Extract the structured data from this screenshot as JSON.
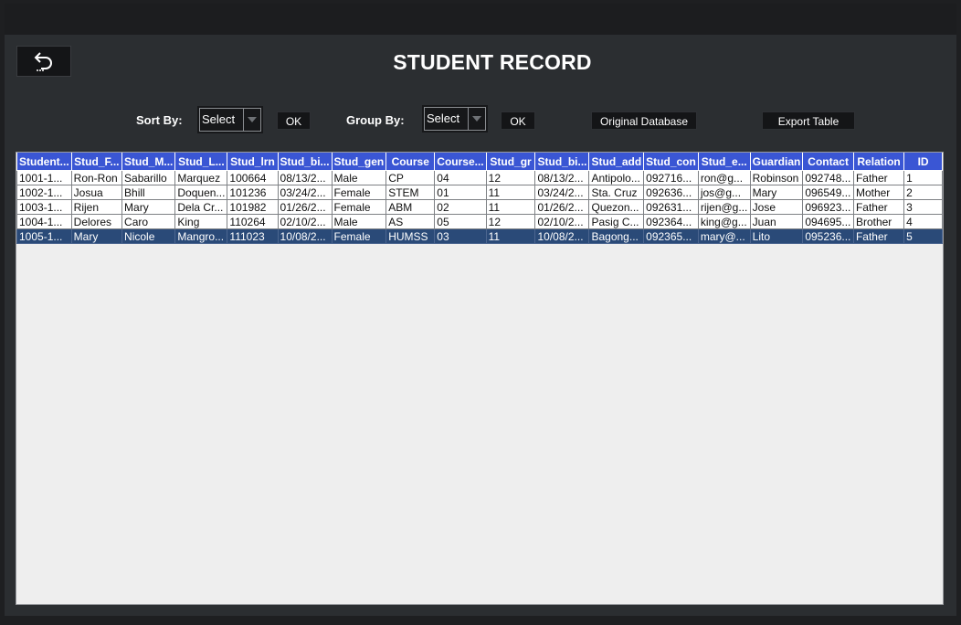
{
  "header": {
    "title": "STUDENT RECORD",
    "back_icon": "back-arrow-icon"
  },
  "controls": {
    "sort_label": "Sort By:",
    "sort_value": "Select",
    "sort_ok": "OK",
    "group_label": "Group By:",
    "group_value": "Select",
    "group_ok": "OK",
    "original_db": "Original Database",
    "export_table": "Export Table"
  },
  "table": {
    "columns": [
      "Student...",
      "Stud_F...",
      "Stud_M...",
      "Stud_L...",
      "Stud_lrn",
      "Stud_bi...",
      "Stud_gen",
      "Course",
      "Course...",
      "Stud_gr",
      "Stud_bi...",
      "Stud_add",
      "Stud_con",
      "Stud_e...",
      "Guardian",
      "Contact",
      "Relation",
      "ID"
    ],
    "rows": [
      [
        "1001-1...",
        "Ron-Ron",
        "Sabarillo",
        "Marquez",
        "100664",
        "08/13/2...",
        "Male",
        "CP",
        "04",
        "12",
        "08/13/2...",
        "Antipolo...",
        "092716...",
        "ron@g...",
        "Robinson",
        "092748...",
        "Father",
        "1"
      ],
      [
        "1002-1...",
        "Josua",
        "Bhill",
        "Doquen...",
        "101236",
        "03/24/2...",
        "Female",
        "STEM",
        "01",
        "11",
        "03/24/2...",
        "Sta. Cruz",
        "092636...",
        "jos@g...",
        "Mary",
        "096549...",
        "Mother",
        "2"
      ],
      [
        "1003-1...",
        "Rijen",
        "Mary",
        "Dela Cr...",
        "101982",
        "01/26/2...",
        "Female",
        "ABM",
        "02",
        "11",
        "01/26/2...",
        "Quezon...",
        "092631...",
        "rijen@g...",
        "Jose",
        "096923...",
        "Father",
        "3"
      ],
      [
        "1004-1...",
        "Delores",
        "Caro",
        "King",
        "110264",
        "02/10/2...",
        "Male",
        "AS",
        "05",
        "12",
        "02/10/2...",
        "Pasig C...",
        "092364...",
        "king@g...",
        "Juan",
        "094695...",
        "Brother",
        "4"
      ],
      [
        "1005-1...",
        "Mary",
        "Nicole",
        "Mangro...",
        "111023",
        "10/08/2...",
        "Female",
        "HUMSS",
        "03",
        "11",
        "10/08/2...",
        "Bagong...",
        "092365...",
        "mary@...",
        "Lito",
        "095236...",
        "Father",
        "5"
      ]
    ],
    "selected_row": 4
  },
  "colors": {
    "header_bg": "#3a56d4",
    "selected_row_bg": "#2a4a78",
    "panel_bg": "#2b2e31"
  }
}
